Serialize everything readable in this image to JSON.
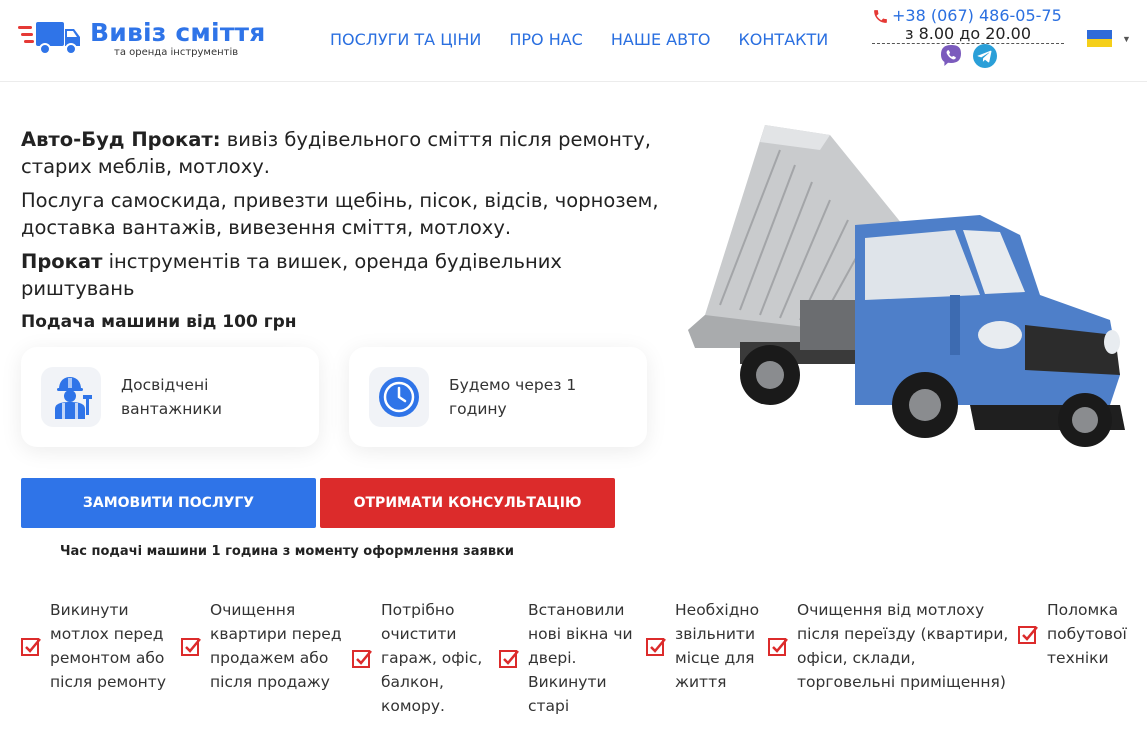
{
  "header": {
    "logo_title": "Вивіз сміття",
    "logo_subtitle": "та оренда інструментів",
    "nav": [
      "ПОСЛУГИ ТА ЦІНИ",
      "ПРО НАС",
      "НАШЕ АВТО",
      "КОНТАКТИ"
    ],
    "phone": "+38 (067) 486-05-75",
    "hours": "з 8.00 до 20.00",
    "messengers": [
      "viber-icon",
      "telegram-icon"
    ],
    "language_flag": "ukraine-flag"
  },
  "hero": {
    "p1_bold": "Авто-Буд Прокат:",
    "p1_rest": " вивіз будівельного сміття після ремонту, старих меблів, мотлоху.",
    "p2": "Послуга самоскида, привезти щебінь, пісок, відсів, чорнозем, доставка вантажів, вивезення сміття, мотлоху.",
    "p3_bold": "Прокат",
    "p3_rest": " інструментів та вишек, оренда будівельних риштувань",
    "p4": "Подача машини від 100 грн"
  },
  "features": [
    {
      "icon": "worker-icon",
      "text_line1": "Досвідчені",
      "text_line2": "вантажники"
    },
    {
      "icon": "clock-icon",
      "text_line1": "Будемо через 1",
      "text_line2": "годину"
    }
  ],
  "buttons": {
    "order": "ЗАМОВИТИ ПОСЛУГУ",
    "consult": "ОТРИМАТИ КОНСУЛЬТАЦІЮ"
  },
  "note": "Час подачі машини 1 година з моменту оформлення заявки",
  "checklist": [
    {
      "lines": [
        "Викинути",
        "мотлох перед",
        "ремонтом або",
        "після ремонту"
      ]
    },
    {
      "lines": [
        "Очищення",
        "квартири перед",
        "продажем або",
        "після продажу"
      ]
    },
    {
      "lines": [
        "Потрібно",
        "очистити",
        "гараж, офіс,",
        "балкон,",
        "комору."
      ]
    },
    {
      "lines": [
        "Встановили",
        "нові вікна чи",
        "двері.",
        "Викинути",
        "старі"
      ]
    },
    {
      "lines": [
        "Необхідно",
        "звільнити",
        "місце для",
        "життя"
      ]
    },
    {
      "lines": [
        "Очищення від мотлоху",
        "після переїзду (квартири,",
        "офіси, склади,",
        "торговельні приміщення)"
      ]
    },
    {
      "lines": [
        "Поломка",
        "побутової",
        "техніки"
      ]
    }
  ],
  "colors": {
    "accent_blue": "#2f74e8",
    "accent_red": "#dc2b2b"
  }
}
